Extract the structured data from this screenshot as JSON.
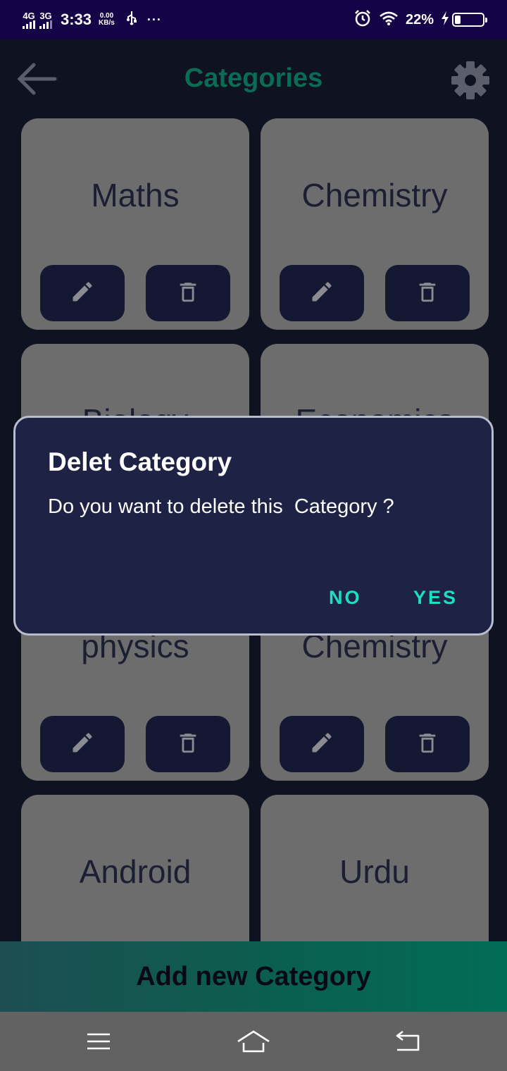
{
  "status_bar": {
    "network_1": "4G",
    "network_2": "3G",
    "time": "3:33",
    "speed_value": "0.00",
    "speed_unit": "KB/s",
    "more": "···",
    "battery_percent": "22%",
    "battery_level": 0.22
  },
  "header": {
    "title": "Categories"
  },
  "categories": [
    {
      "name": "Maths"
    },
    {
      "name": "Chemistry"
    },
    {
      "name": "Biology"
    },
    {
      "name": "Economics"
    },
    {
      "name": "physics"
    },
    {
      "name": "Chemistry"
    },
    {
      "name": "Android"
    },
    {
      "name": "Urdu"
    }
  ],
  "dialog": {
    "title": "Delet Category",
    "message": "Do you want to delete this  Category ?",
    "no_label": "NO",
    "yes_label": "YES"
  },
  "add_button": {
    "label": "Add new Category"
  },
  "colors": {
    "status_bar": "#140447",
    "title": "#0c6b54",
    "card": "#6d6d6d",
    "dialog_bg": "#1e2345",
    "dialog_action": "#19e0c1"
  }
}
